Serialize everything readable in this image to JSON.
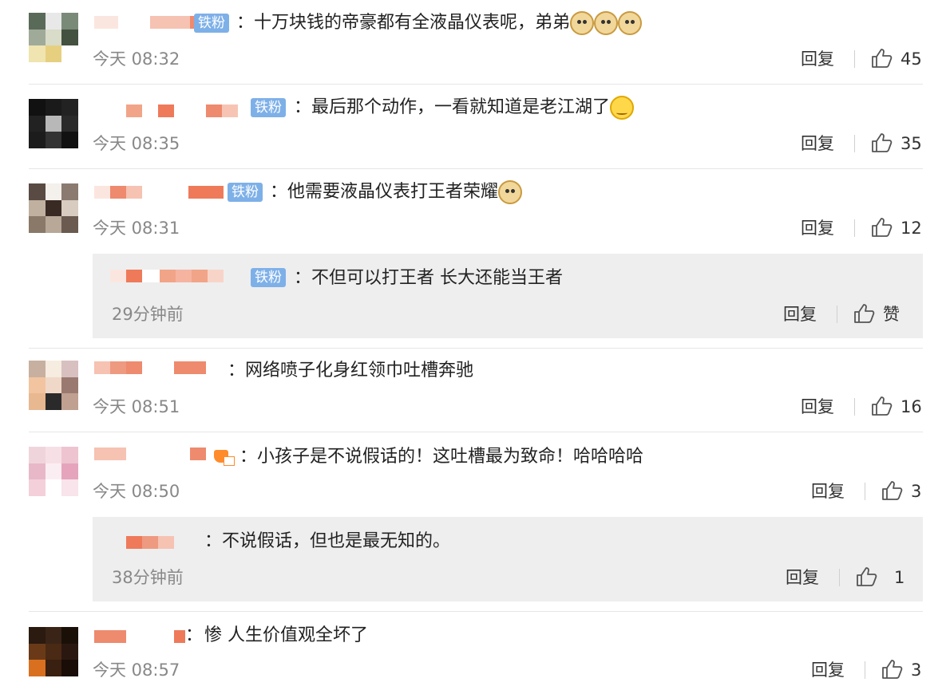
{
  "labels": {
    "badge": "铁粉",
    "reply": "回复",
    "like": "赞",
    "colon": "："
  },
  "comments": [
    {
      "text": "十万块钱的帝豪都有全液晶仪表呢，弟弟",
      "time": "今天 08:32",
      "likes": "45"
    },
    {
      "text": "最后那个动作，一看就知道是老江湖了",
      "time": "今天 08:35",
      "likes": "35"
    },
    {
      "text": "他需要液晶仪表打王者荣耀",
      "time": "今天 08:31",
      "likes": "12",
      "reply": {
        "text": "不但可以打王者 长大还能当王者",
        "time": "29分钟前"
      }
    },
    {
      "text": "网络喷子化身红领巾吐槽奔驰",
      "time": "今天 08:51",
      "likes": "16"
    },
    {
      "text": "小孩子是不说假话的！这吐槽最为致命！哈哈哈哈",
      "time": "今天 08:50",
      "likes": "3",
      "reply": {
        "text": "不说假话，但也是最无知的。",
        "time": "38分钟前",
        "likes": "1"
      }
    },
    {
      "text": "惨  人生价值观全坏了",
      "time": "今天 08:57",
      "likes": "3"
    }
  ]
}
